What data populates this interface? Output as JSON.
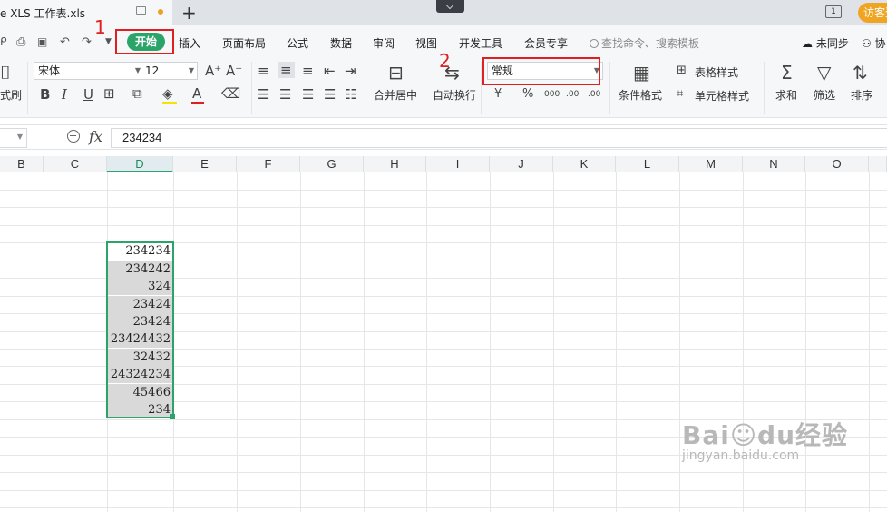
{
  "titlebar": {
    "doc_title": "е XLS 工作表.xls",
    "add_tab": "+",
    "window_badge": "1",
    "guest_label": "访客登"
  },
  "menu": {
    "tabs": [
      "开始",
      "插入",
      "页面布局",
      "公式",
      "数据",
      "审阅",
      "视图",
      "开发工具",
      "会员专享"
    ],
    "search_placeholder": "查找命令、搜索模板",
    "sync_label": "未同步",
    "collab_label": "协"
  },
  "ribbon": {
    "format_painter": "式刷",
    "font_name": "宋体",
    "font_size": "12",
    "merge_center": "合并居中",
    "wrap_text": "自动换行",
    "number_format": "常规",
    "currency_symbol": "¥",
    "percent_symbol": "%",
    "thousands": "000",
    "inc_decimal": ".00",
    "dec_decimal": ".00",
    "cond_format": "条件格式",
    "table_style": "表格样式",
    "cell_style": "单元格样式",
    "sum": "求和",
    "filter": "筛选",
    "sort": "排序",
    "bold": "B",
    "italic": "I",
    "underline": "U",
    "font_color_letter": "A"
  },
  "annotations": {
    "label_1": "1",
    "label_2": "2"
  },
  "formula_bar": {
    "fx": "fx",
    "value": "234234"
  },
  "grid": {
    "columns": [
      "B",
      "C",
      "D",
      "E",
      "F",
      "G",
      "H",
      "I",
      "J",
      "K",
      "L",
      "M",
      "N",
      "O"
    ],
    "selected_column": "D",
    "d_values": [
      "234234",
      "234242",
      "324",
      "23424",
      "23424",
      "23424432",
      "32432",
      "24324234",
      "45466",
      "234"
    ]
  },
  "watermark": {
    "brand": "Bai☺du经验",
    "url": "jingyan.baidu.com"
  },
  "colors": {
    "accent_green": "#2ba46a",
    "annotation_red": "#e02020",
    "guest_orange": "#f0a522"
  }
}
